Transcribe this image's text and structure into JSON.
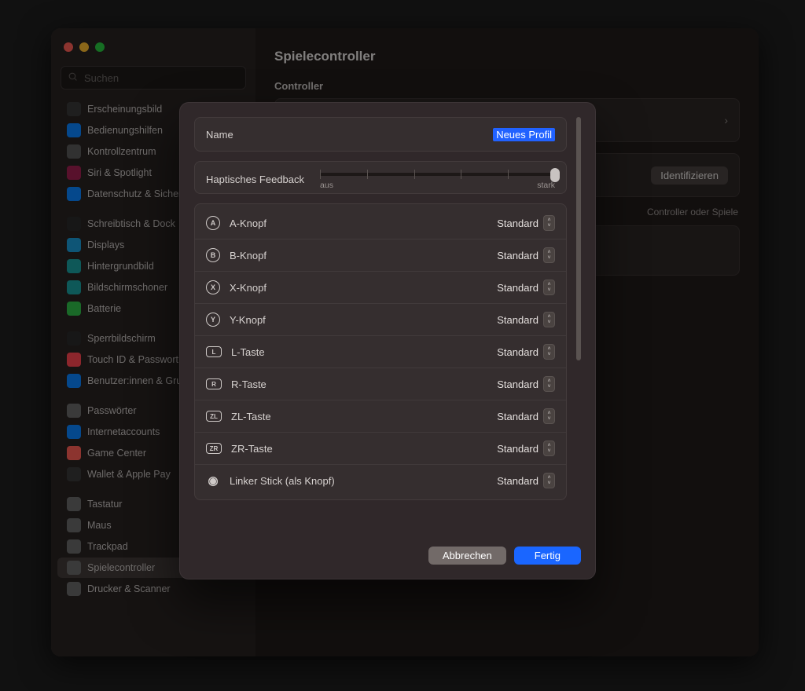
{
  "search_placeholder": "Suchen",
  "page_title": "Spielecontroller",
  "section_controller": "Controller",
  "identify_label": "Identifizieren",
  "profile_hint": "Controller oder Spiele",
  "sidebar": {
    "groups": [
      [
        {
          "label": "Erscheinungsbild",
          "color": "#3a3a3a"
        },
        {
          "label": "Bedienungshilfen",
          "color": "#0a84ff"
        },
        {
          "label": "Kontrollzentrum",
          "color": "#5a5a5a"
        },
        {
          "label": "Siri & Spotlight",
          "color": "#a02050"
        },
        {
          "label": "Datenschutz & Sicherheit",
          "color": "#0a84ff"
        }
      ],
      [
        {
          "label": "Schreibtisch & Dock",
          "color": "#2a2a2a"
        },
        {
          "label": "Displays",
          "color": "#1a9bd8"
        },
        {
          "label": "Hintergrundbild",
          "color": "#1aa0a0"
        },
        {
          "label": "Bildschirmschoner",
          "color": "#1aa0a0"
        },
        {
          "label": "Batterie",
          "color": "#30c04a"
        }
      ],
      [
        {
          "label": "Sperrbildschirm",
          "color": "#2a2a2a"
        },
        {
          "label": "Touch ID & Passwort",
          "color": "#ff4550"
        },
        {
          "label": "Benutzer:innen & Gruppen",
          "color": "#0a84ff"
        }
      ],
      [
        {
          "label": "Passwörter",
          "color": "#6a6a6a"
        },
        {
          "label": "Internetaccounts",
          "color": "#0a84ff"
        },
        {
          "label": "Game Center",
          "color": "#ff5f57"
        },
        {
          "label": "Wallet & Apple Pay",
          "color": "#3a3a3a"
        }
      ],
      [
        {
          "label": "Tastatur",
          "color": "#6a6a6a"
        },
        {
          "label": "Maus",
          "color": "#6a6a6a"
        },
        {
          "label": "Trackpad",
          "color": "#6a6a6a"
        },
        {
          "label": "Spielecontroller",
          "color": "#6a6a6a",
          "active": true
        },
        {
          "label": "Drucker & Scanner",
          "color": "#6a6a6a"
        }
      ]
    ]
  },
  "sheet": {
    "name_label": "Name",
    "name_value": "Neues Profil",
    "haptic_label": "Haptisches Feedback",
    "haptic_min": "aus",
    "haptic_max": "stark",
    "mappings": [
      {
        "glyph": "A",
        "shape": "circle",
        "label": "A-Knopf",
        "value": "Standard"
      },
      {
        "glyph": "B",
        "shape": "circle",
        "label": "B-Knopf",
        "value": "Standard"
      },
      {
        "glyph": "X",
        "shape": "circle",
        "label": "X-Knopf",
        "value": "Standard"
      },
      {
        "glyph": "Y",
        "shape": "circle",
        "label": "Y-Knopf",
        "value": "Standard"
      },
      {
        "glyph": "L",
        "shape": "rect",
        "label": "L-Taste",
        "value": "Standard"
      },
      {
        "glyph": "R",
        "shape": "rect",
        "label": "R-Taste",
        "value": "Standard"
      },
      {
        "glyph": "ZL",
        "shape": "rect",
        "label": "ZL-Taste",
        "value": "Standard"
      },
      {
        "glyph": "ZR",
        "shape": "rect",
        "label": "ZR-Taste",
        "value": "Standard"
      },
      {
        "glyph": "◉",
        "shape": "stick",
        "label": "Linker Stick (als Knopf)",
        "value": "Standard"
      }
    ],
    "cancel": "Abbrechen",
    "done": "Fertig"
  }
}
